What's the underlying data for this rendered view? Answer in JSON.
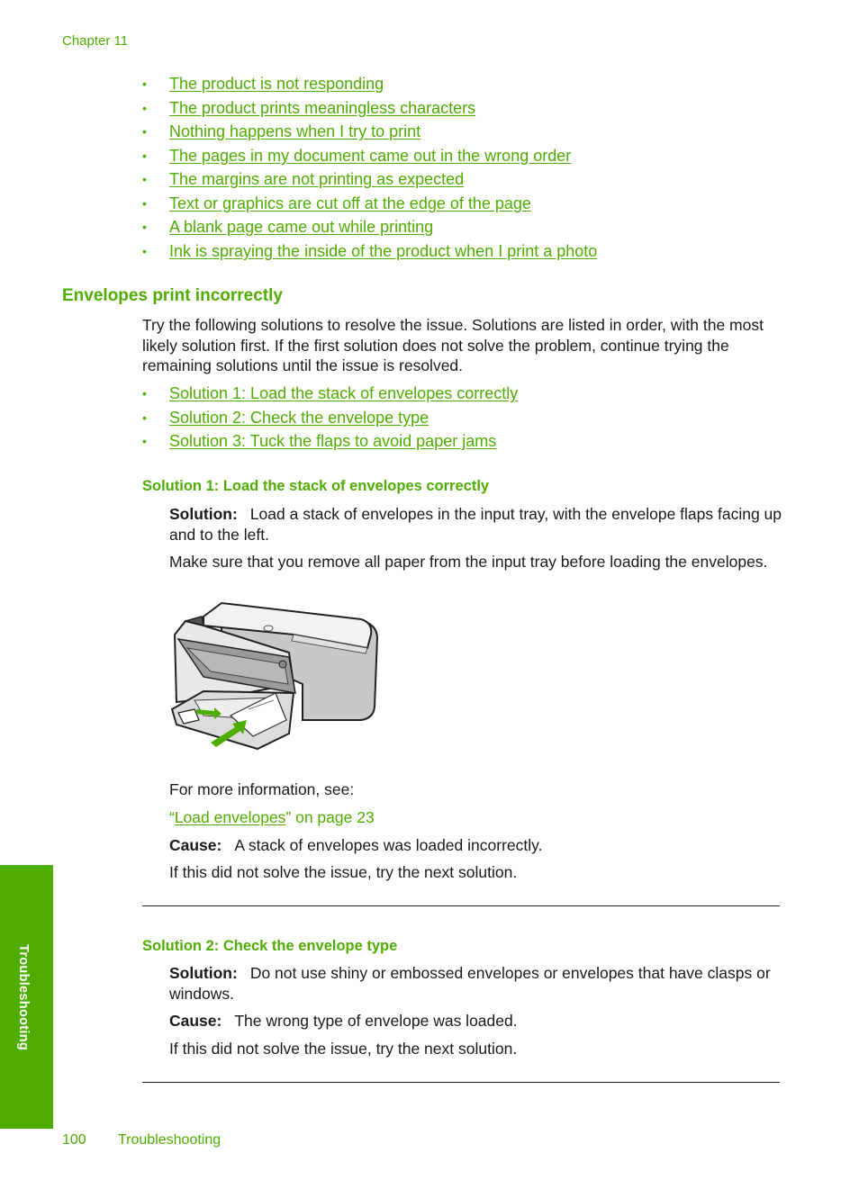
{
  "header": {
    "chapter": "Chapter 11"
  },
  "top_links": [
    "The product is not responding",
    "The product prints meaningless characters",
    "Nothing happens when I try to print",
    "The pages in my document came out in the wrong order",
    "The margins are not printing as expected",
    "Text or graphics are cut off at the edge of the page",
    "A blank page came out while printing",
    "Ink is spraying the inside of the product when I print a photo"
  ],
  "section": {
    "title": "Envelopes print incorrectly",
    "intro": "Try the following solutions to resolve the issue. Solutions are listed in order, with the most likely solution first. If the first solution does not solve the problem, continue trying the remaining solutions until the issue is resolved.",
    "solution_links": [
      "Solution 1: Load the stack of envelopes correctly",
      "Solution 2: Check the envelope type",
      "Solution 3: Tuck the flaps to avoid paper jams"
    ]
  },
  "solution1": {
    "title": "Solution 1: Load the stack of envelopes correctly",
    "solution_label": "Solution:",
    "solution_text": "Load a stack of envelopes in the input tray, with the envelope flaps facing up and to the left.",
    "note": "Make sure that you remove all paper from the input tray before loading the envelopes.",
    "figure_alt": "printer-loading-envelopes-illustration",
    "more_info": "For more information, see:",
    "ref_open_quote": "“",
    "ref_link": "Load envelopes",
    "ref_suffix": "” on page 23",
    "cause_label": "Cause:",
    "cause_text": "A stack of envelopes was loaded incorrectly.",
    "next": "If this did not solve the issue, try the next solution."
  },
  "solution2": {
    "title": "Solution 2: Check the envelope type",
    "solution_label": "Solution:",
    "solution_text": "Do not use shiny or embossed envelopes or envelopes that have clasps or windows.",
    "cause_label": "Cause:",
    "cause_text": "The wrong type of envelope was loaded.",
    "next": "If this did not solve the issue, try the next solution."
  },
  "side_tab": {
    "label": "Troubleshooting"
  },
  "footer": {
    "page_number": "100",
    "section": "Troubleshooting"
  },
  "colors": {
    "accent": "#4fad00",
    "text": "#1a1a1a"
  }
}
